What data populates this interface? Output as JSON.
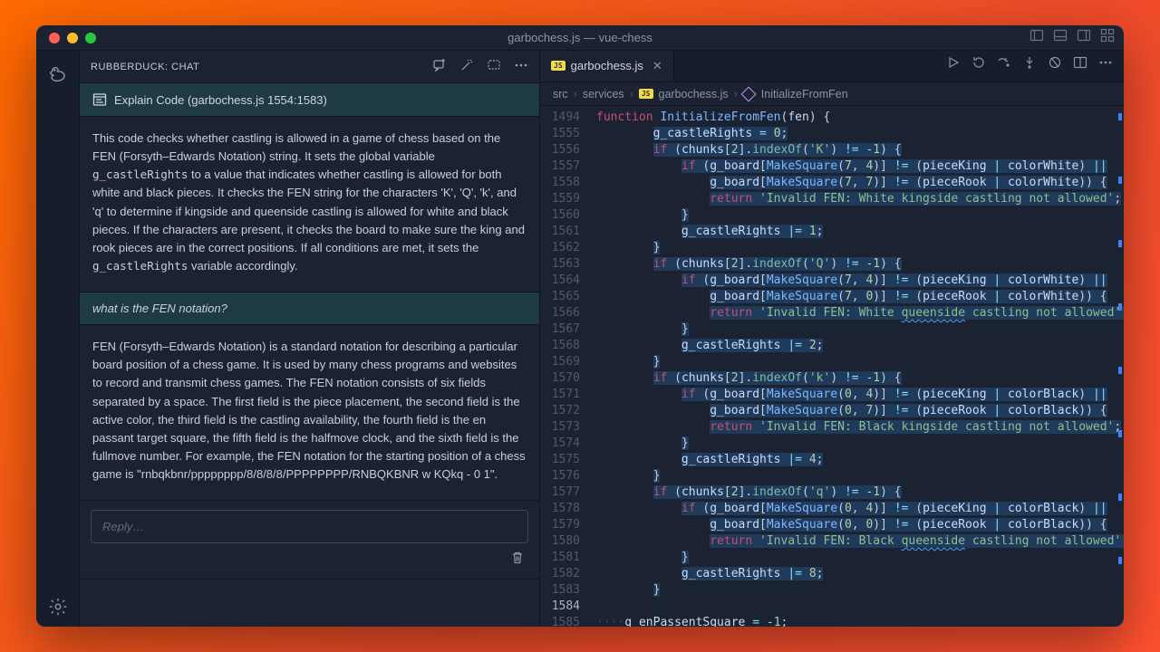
{
  "window": {
    "title": "garbochess.js — vue-chess"
  },
  "chat": {
    "header": "RUBBERDUCK: CHAT",
    "topic": "Explain Code (garbochess.js 1554:1583)",
    "messages": [
      {
        "role": "assistant",
        "html": "This code checks whether castling is allowed in a game of chess based on the FEN (Forsyth–Edwards Notation) string. It sets the global variable <code>g_castleRights</code> to a value that indicates whether castling is allowed for both white and black pieces. It checks the FEN string for the characters 'K', 'Q', 'k', and 'q' to determine if kingside and queenside castling is allowed for white and black pieces. If the characters are present, it checks the board to make sure the king and rook pieces are in the correct positions. If all conditions are met, it sets the <code>g_castleRights</code> variable accordingly."
      },
      {
        "role": "user",
        "text": "what is the FEN notation?"
      },
      {
        "role": "assistant",
        "html": "FEN (Forsyth–Edwards Notation) is a standard notation for describing a particular board position of a chess game. It is used by many chess programs and websites to record and transmit chess games. The FEN notation consists of six fields separated by a space. The first field is the piece placement, the second field is the active color, the third field is the castling availability, the fourth field is the en passant target square, the fifth field is the halfmove clock, and the sixth field is the fullmove number. For example, the FEN notation for the starting position of a chess game is \"rnbqkbnr/pppppppp/8/8/8/8/PPPPPPPP/RNBQKBNR w KQkq - 0 1\"."
      }
    ],
    "reply_placeholder": "Reply…"
  },
  "editor": {
    "tab": {
      "filename": "garbochess.js"
    },
    "breadcrumb": {
      "segments": [
        "src",
        "services",
        "garbochess.js",
        "InitializeFromFen"
      ]
    },
    "signature_line": 1494,
    "line_start": 1555,
    "line_end": 1585,
    "current_line": 1584,
    "lines": [
      {
        "n": 1555,
        "html": "        <span class='sel'><span class='id'>g_castleRights</span> <span class='op'>=</span> <span class='num'>0</span>;</span>"
      },
      {
        "n": 1556,
        "html": "        <span class='sel'><span class='kw'>if</span> (<span class='id'>chunks</span>[<span class='num'>2</span>].<span class='prop'>indexOf</span>(<span class='str'>'K'</span>) <span class='op'>!=</span> <span class='op'>-</span><span class='num'>1</span>) {</span>"
      },
      {
        "n": 1557,
        "html": "            <span class='sel'><span class='kw'>if</span> (<span class='id'>g_board</span>[<span class='fn'>MakeSquare</span>(<span class='num'>7</span>, <span class='num'>4</span>)] <span class='op'>!=</span> (<span class='id'>pieceKing</span> <span class='op'>|</span> <span class='id'>colorWhite</span>) <span class='op'>||</span></span>"
      },
      {
        "n": 1558,
        "html": "                <span class='sel'><span class='id'>g_board</span>[<span class='fn'>MakeSquare</span>(<span class='num'>7</span>, <span class='num'>7</span>)] <span class='op'>!=</span> (<span class='id'>pieceRook</span> <span class='op'>|</span> <span class='id'>colorWhite</span>)) {</span>"
      },
      {
        "n": 1559,
        "html": "                <span class='sel'><span class='kw'>return</span> <span class='str'>'Invalid FEN: White kingside castling not allowed'</span>;</span>"
      },
      {
        "n": 1560,
        "html": "            <span class='sel'>}</span>"
      },
      {
        "n": 1561,
        "html": "            <span class='sel'><span class='id'>g_castleRights</span> <span class='op'>|=</span> <span class='num'>1</span>;</span>"
      },
      {
        "n": 1562,
        "html": "        <span class='sel'>}</span>"
      },
      {
        "n": 1563,
        "html": "        <span class='sel'><span class='kw'>if</span> (<span class='id'>chunks</span>[<span class='num'>2</span>].<span class='prop'>indexOf</span>(<span class='str'>'Q'</span>) <span class='op'>!=</span> <span class='op'>-</span><span class='num'>1</span>) {</span>"
      },
      {
        "n": 1564,
        "html": "            <span class='sel'><span class='kw'>if</span> (<span class='id'>g_board</span>[<span class='fn'>MakeSquare</span>(<span class='num'>7</span>, <span class='num'>4</span>)] <span class='op'>!=</span> (<span class='id'>pieceKing</span> <span class='op'>|</span> <span class='id'>colorWhite</span>) <span class='op'>||</span></span>"
      },
      {
        "n": 1565,
        "html": "                <span class='sel'><span class='id'>g_board</span>[<span class='fn'>MakeSquare</span>(<span class='num'>7</span>, <span class='num'>0</span>)] <span class='op'>!=</span> (<span class='id'>pieceRook</span> <span class='op'>|</span> <span class='id'>colorWhite</span>)) {</span>"
      },
      {
        "n": 1566,
        "html": "                <span class='sel'><span class='kw'>return</span> <span class='str'>'Invalid FEN: White <span class='squig'>queenside</span> castling not allowed'</span>;</span>"
      },
      {
        "n": 1567,
        "html": "            <span class='sel'>}</span>"
      },
      {
        "n": 1568,
        "html": "            <span class='sel'><span class='id'>g_castleRights</span> <span class='op'>|=</span> <span class='num'>2</span>;</span>"
      },
      {
        "n": 1569,
        "html": "        <span class='sel'>}</span>"
      },
      {
        "n": 1570,
        "html": "        <span class='sel'><span class='kw'>if</span> (<span class='id'>chunks</span>[<span class='num'>2</span>].<span class='prop'>indexOf</span>(<span class='str'>'k'</span>) <span class='op'>!=</span> <span class='op'>-</span><span class='num'>1</span>) {</span>"
      },
      {
        "n": 1571,
        "html": "            <span class='sel'><span class='kw'>if</span> (<span class='id'>g_board</span>[<span class='fn'>MakeSquare</span>(<span class='num'>0</span>, <span class='num'>4</span>)] <span class='op'>!=</span> (<span class='id'>pieceKing</span> <span class='op'>|</span> <span class='id'>colorBlack</span>) <span class='op'>||</span></span>"
      },
      {
        "n": 1572,
        "html": "                <span class='sel'><span class='id'>g_board</span>[<span class='fn'>MakeSquare</span>(<span class='num'>0</span>, <span class='num'>7</span>)] <span class='op'>!=</span> (<span class='id'>pieceRook</span> <span class='op'>|</span> <span class='id'>colorBlack</span>)) {</span>"
      },
      {
        "n": 1573,
        "html": "                <span class='sel'><span class='kw'>return</span> <span class='str'>'Invalid FEN: Black kingside castling not allowed'</span>;</span>"
      },
      {
        "n": 1574,
        "html": "            <span class='sel'>}</span>"
      },
      {
        "n": 1575,
        "html": "            <span class='sel'><span class='id'>g_castleRights</span> <span class='op'>|=</span> <span class='num'>4</span>;</span>"
      },
      {
        "n": 1576,
        "html": "        <span class='sel'>}</span>"
      },
      {
        "n": 1577,
        "html": "        <span class='sel'><span class='kw'>if</span> (<span class='id'>chunks</span>[<span class='num'>2</span>].<span class='prop'>indexOf</span>(<span class='str'>'q'</span>) <span class='op'>!=</span> <span class='op'>-</span><span class='num'>1</span>) {</span>"
      },
      {
        "n": 1578,
        "html": "            <span class='sel'><span class='kw'>if</span> (<span class='id'>g_board</span>[<span class='fn'>MakeSquare</span>(<span class='num'>0</span>, <span class='num'>4</span>)] <span class='op'>!=</span> (<span class='id'>pieceKing</span> <span class='op'>|</span> <span class='id'>colorBlack</span>) <span class='op'>||</span></span>"
      },
      {
        "n": 1579,
        "html": "                <span class='sel'><span class='id'>g_board</span>[<span class='fn'>MakeSquare</span>(<span class='num'>0</span>, <span class='num'>0</span>)] <span class='op'>!=</span> (<span class='id'>pieceRook</span> <span class='op'>|</span> <span class='id'>colorBlack</span>)) {</span>"
      },
      {
        "n": 1580,
        "html": "                <span class='sel'><span class='kw'>return</span> <span class='str'>'Invalid FEN: Black <span class='squig'>queenside</span> castling not allowed'</span>;</span>"
      },
      {
        "n": 1581,
        "html": "            <span class='sel'>}</span>"
      },
      {
        "n": 1582,
        "html": "            <span class='sel'><span class='id'>g_castleRights</span> <span class='op'>|=</span> <span class='num'>8</span>;</span>"
      },
      {
        "n": 1583,
        "html": "        <span class='sel'>}</span>"
      },
      {
        "n": 1584,
        "html": ""
      },
      {
        "n": 1585,
        "html": "<span style='color:#3a4459'>····</span><span class='id'>g_enPassentSquare</span> <span class='op'>=</span> <span class='op'>-</span><span class='num'>1</span>;"
      }
    ]
  }
}
